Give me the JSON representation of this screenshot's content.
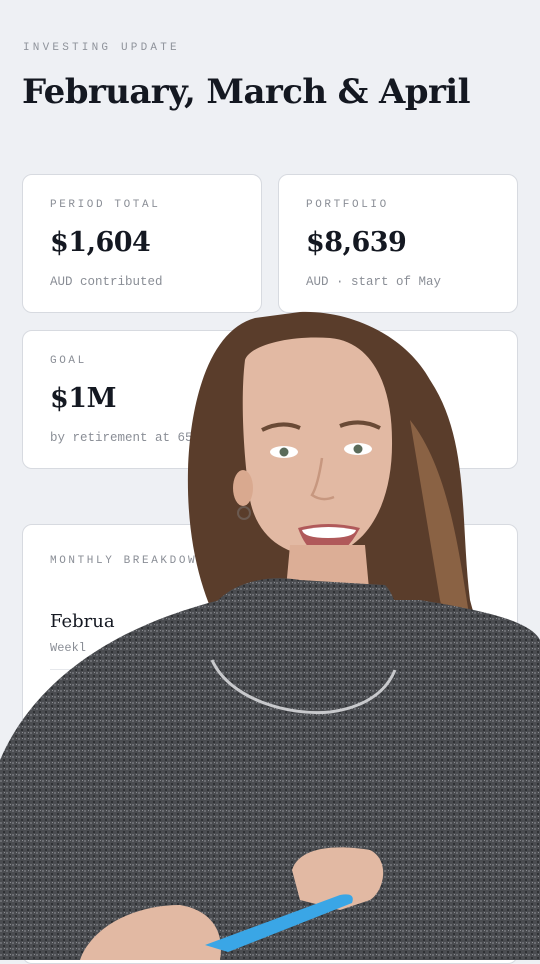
{
  "header": {
    "eyebrow": "INVESTING UPDATE",
    "title": "February, March & April"
  },
  "cards": {
    "period": {
      "label": "PERIOD TOTAL",
      "value": "$1,604",
      "sub": "AUD contributed"
    },
    "portfolio": {
      "label": "PORTFOLIO",
      "value": "$8,639",
      "sub": "AUD · start of May"
    },
    "goal": {
      "label": "GOAL",
      "value": "$1M",
      "sub": "by retirement at 65"
    }
  },
  "breakdown": {
    "label": "MONTHLY BREAKDOWN",
    "rows": [
      {
        "name": "Februa",
        "sub": "Weekl"
      }
    ]
  },
  "colors": {
    "background": "#eef0f4",
    "card": "#ffffff",
    "ink": "#141821",
    "muted": "#8a8e96",
    "sweater": "#4a4c50",
    "pen": "#3aa6e6"
  }
}
